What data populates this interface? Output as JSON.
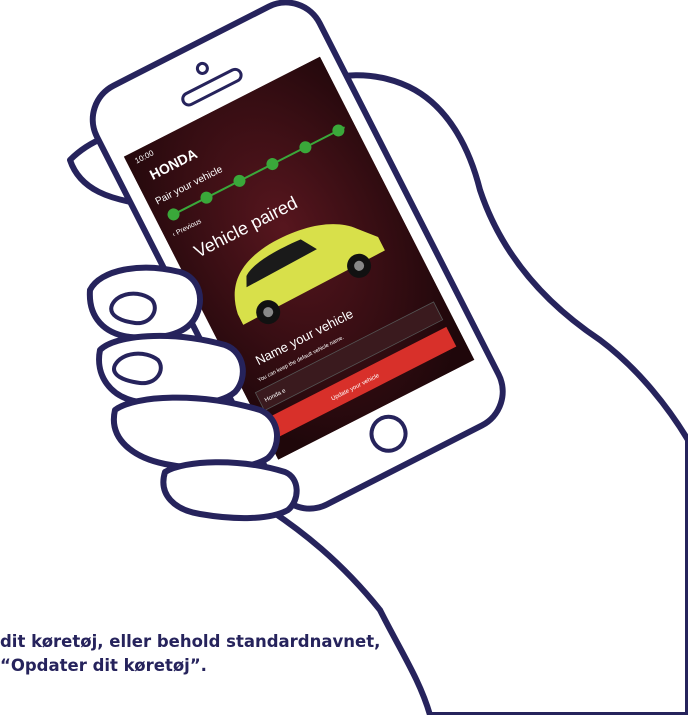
{
  "phone_screen": {
    "status_time": "10:00",
    "brand": "HONDA",
    "step_title": "Pair your vehicle",
    "back_link": "‹ Previous",
    "headline": "Vehicle paired",
    "name_heading": "Name your vehicle",
    "name_hint": "You can keep the default vehicle name.",
    "name_input_value": "Honda e",
    "update_button": "Update your vehicle",
    "progress_steps_completed": 6,
    "accent_color": "#3aa83a",
    "button_color": "#d8302a"
  },
  "caption": {
    "line1": "dit køretøj, eller behold standardnavnet,",
    "line2": "“Opdater dit køretøj”."
  },
  "colors": {
    "outline": "#26235c",
    "screen_bg": "#2a0c10",
    "car_body": "#d8e04a"
  }
}
